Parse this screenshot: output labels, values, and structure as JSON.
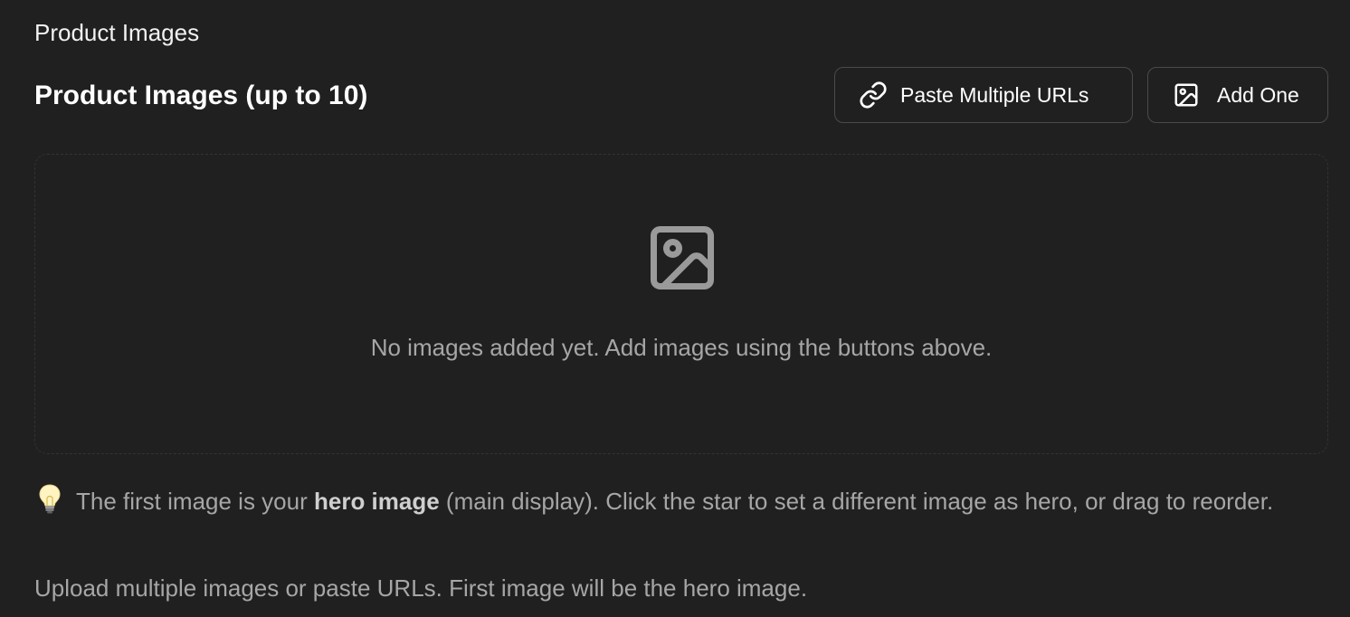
{
  "section_label": "Product Images",
  "heading": "Product Images (up to 10)",
  "buttons": {
    "paste_multiple": {
      "label": "Paste Multiple URLs",
      "icon": "link-icon"
    },
    "add_one": {
      "label": "Add One",
      "icon": "image-icon"
    }
  },
  "dropzone": {
    "icon": "image-placeholder-icon",
    "empty_text": "No images added yet. Add images using the buttons above."
  },
  "tip": {
    "icon": "lightbulb-icon",
    "before": "The first image is your ",
    "bold": "hero image",
    "after": " (main display). Click the star to set a different image as hero, or drag to reorder."
  },
  "help_text": "Upload multiple images or paste URLs. First image will be the hero image.",
  "colors": {
    "background": "#202020",
    "border": "#4a4a4a",
    "muted_text": "#a6a6a6",
    "icon_gray": "#9a9a9a"
  }
}
